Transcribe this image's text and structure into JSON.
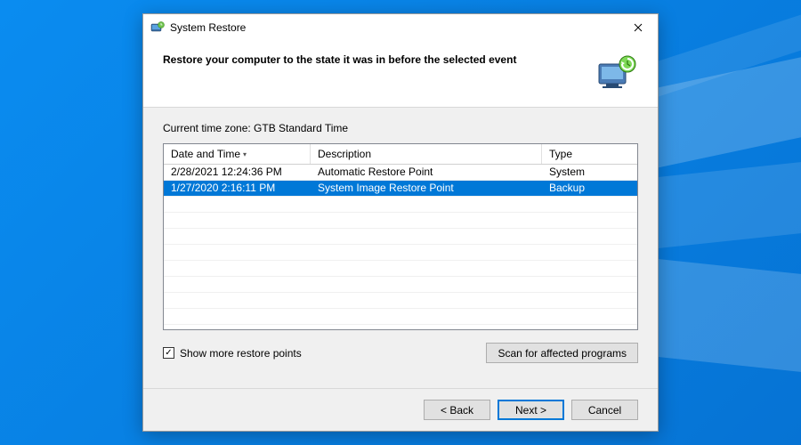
{
  "window": {
    "title": "System Restore",
    "heading": "Restore your computer to the state it was in before the selected event"
  },
  "timezone_label": "Current time zone: GTB Standard Time",
  "columns": {
    "date_time": "Date and Time",
    "description": "Description",
    "type": "Type"
  },
  "restore_points": [
    {
      "date_time": "2/28/2021 12:24:36 PM",
      "description": "Automatic Restore Point",
      "type": "System",
      "selected": false
    },
    {
      "date_time": "1/27/2020 2:16:11 PM",
      "description": "System Image Restore Point",
      "type": "Backup",
      "selected": true
    }
  ],
  "checkbox": {
    "show_more": {
      "label": "Show more restore points",
      "checked": true
    }
  },
  "buttons": {
    "scan": "Scan for affected programs",
    "back": "< Back",
    "next": "Next >",
    "cancel": "Cancel"
  }
}
